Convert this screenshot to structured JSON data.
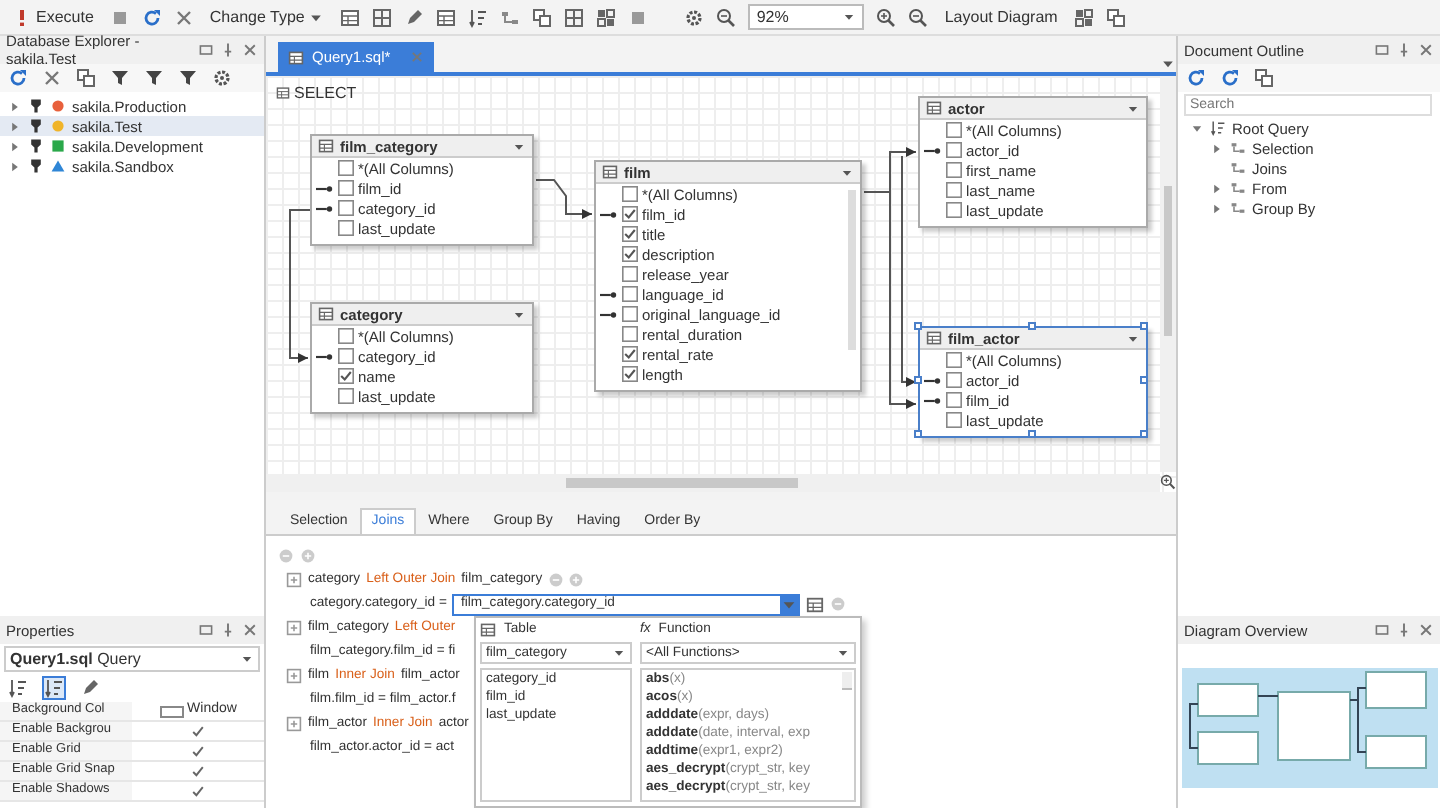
{
  "toolbar": {
    "execute": "Execute",
    "change_type": "Change Type",
    "zoom": "92%",
    "layout": "Layout Diagram"
  },
  "explorer": {
    "title": "Database Explorer - sakila.Test",
    "connections": [
      {
        "label": "sakila.Production",
        "kind": "circle",
        "color": "#e8603c",
        "selected": false
      },
      {
        "label": "sakila.Test",
        "kind": "circle",
        "color": "#f0b429",
        "selected": true
      },
      {
        "label": "sakila.Development",
        "kind": "square",
        "color": "#2aa84a",
        "selected": false
      },
      {
        "label": "sakila.Sandbox",
        "kind": "triangle",
        "color": "#2f86d6",
        "selected": false
      }
    ]
  },
  "properties": {
    "title": "Properties",
    "object": "Query1.sql",
    "object_type": "Query",
    "rows": [
      {
        "kind": "color",
        "name": "Background Col",
        "value": "Window"
      },
      {
        "kind": "check",
        "name": "Enable Backgrou",
        "checked": true
      },
      {
        "kind": "check",
        "name": "Enable Grid",
        "checked": true
      },
      {
        "kind": "check",
        "name": "Enable Grid Snap",
        "checked": true
      },
      {
        "kind": "check",
        "name": "Enable Shadows",
        "checked": true
      }
    ]
  },
  "document": {
    "tab": "Query1.sql*"
  },
  "diagram": {
    "label": "SELECT",
    "tables": [
      {
        "name": "film_category",
        "selected": false,
        "columns": [
          {
            "name": "*(All Columns)",
            "checked": false,
            "linked": false
          },
          {
            "name": "film_id",
            "checked": false,
            "linked": true
          },
          {
            "name": "category_id",
            "checked": false,
            "linked": true
          },
          {
            "name": "last_update",
            "checked": false,
            "linked": false
          }
        ]
      },
      {
        "name": "category",
        "selected": false,
        "columns": [
          {
            "name": "*(All Columns)",
            "checked": false,
            "linked": false
          },
          {
            "name": "category_id",
            "checked": false,
            "linked": true
          },
          {
            "name": "name",
            "checked": true,
            "linked": false
          },
          {
            "name": "last_update",
            "checked": false,
            "linked": false
          }
        ]
      },
      {
        "name": "film",
        "selected": false,
        "columns": [
          {
            "name": "*(All Columns)",
            "checked": false,
            "linked": false
          },
          {
            "name": "film_id",
            "checked": true,
            "linked": true
          },
          {
            "name": "title",
            "checked": true,
            "linked": false
          },
          {
            "name": "description",
            "checked": true,
            "linked": false
          },
          {
            "name": "release_year",
            "checked": false,
            "linked": false
          },
          {
            "name": "language_id",
            "checked": false,
            "linked": true
          },
          {
            "name": "original_language_id",
            "checked": false,
            "linked": true
          },
          {
            "name": "rental_duration",
            "checked": false,
            "linked": false
          },
          {
            "name": "rental_rate",
            "checked": true,
            "linked": false
          },
          {
            "name": "length",
            "checked": true,
            "linked": false
          }
        ]
      },
      {
        "name": "actor",
        "selected": false,
        "columns": [
          {
            "name": "*(All Columns)",
            "checked": false,
            "linked": false
          },
          {
            "name": "actor_id",
            "checked": false,
            "linked": true
          },
          {
            "name": "first_name",
            "checked": false,
            "linked": false
          },
          {
            "name": "last_name",
            "checked": false,
            "linked": false
          },
          {
            "name": "last_update",
            "checked": false,
            "linked": false
          }
        ]
      },
      {
        "name": "film_actor",
        "selected": true,
        "columns": [
          {
            "name": "*(All Columns)",
            "checked": false,
            "linked": false
          },
          {
            "name": "actor_id",
            "checked": false,
            "linked": true
          },
          {
            "name": "film_id",
            "checked": false,
            "linked": true
          },
          {
            "name": "last_update",
            "checked": false,
            "linked": false
          }
        ]
      }
    ]
  },
  "query_tabs": [
    {
      "label": "Selection",
      "selected": false
    },
    {
      "label": "Joins",
      "selected": true
    },
    {
      "label": "Where",
      "selected": false
    },
    {
      "label": "Group By",
      "selected": false
    },
    {
      "label": "Having",
      "selected": false
    },
    {
      "label": "Order By",
      "selected": false
    }
  ],
  "joins": [
    {
      "left": "category",
      "type": "Left Outer Join",
      "right": "film_category",
      "condition": "category.category_id =",
      "value": "film_category.category_id"
    },
    {
      "left": "film_category",
      "type": "Left Outer",
      "condition": "film_category.film_id = fi"
    },
    {
      "left": "film",
      "type": "Inner Join",
      "right": "film_actor",
      "condition": "film.film_id = film_actor.f"
    },
    {
      "left": "film_actor",
      "type": "Inner Join",
      "right": "actor",
      "condition": "film_actor.actor_id = act"
    }
  ],
  "expression_editor": {
    "table_label": "Table",
    "table": "film_category",
    "columns": [
      "category_id",
      "film_id",
      "last_update"
    ],
    "function_icon": "fx",
    "function_label": "Function",
    "function_filter": "<All Functions>",
    "functions": [
      "**abs**(x)",
      "**acos**(x)",
      "**adddate**(expr, days)",
      "**adddate**(date, interval, exp",
      "**addtime**(expr1, expr2)",
      "**aes_decrypt**(crypt_str, key",
      "**aes_decrypt**(crypt_str, key"
    ]
  },
  "outline": {
    "title": "Document Outline",
    "search_placeholder": "Search",
    "tree": [
      {
        "label": "Root Query",
        "expanded": true,
        "children": [
          {
            "label": "Selection",
            "expanded": false
          },
          {
            "label": "Joins"
          },
          {
            "label": "From",
            "expanded": false
          },
          {
            "label": "Group By",
            "expanded": false
          }
        ]
      }
    ]
  },
  "overview": {
    "title": "Diagram Overview"
  }
}
